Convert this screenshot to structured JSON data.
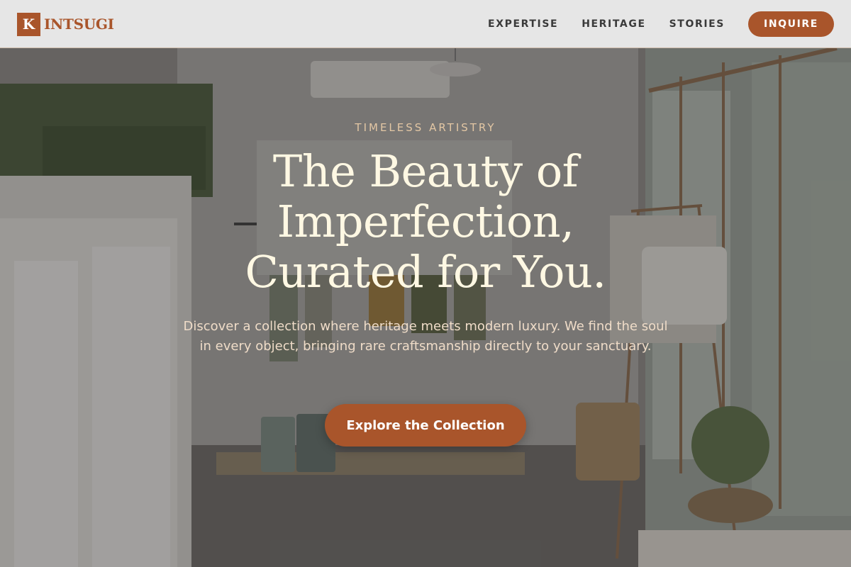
{
  "brand": {
    "mark": "K",
    "name": "INTSUGI",
    "color": "#a9552b"
  },
  "nav": {
    "items": [
      {
        "label": "EXPERTISE"
      },
      {
        "label": "HERITAGE"
      },
      {
        "label": "STORIES"
      }
    ],
    "cta_label": "INQUIRE"
  },
  "hero": {
    "eyebrow": "TIMELESS ARTISTRY",
    "headline_line1": "The Beauty of",
    "headline_line2": "Imperfection,",
    "headline_line3": "Curated for You.",
    "subtext": "Discover a collection where heritage meets modern luxury. We find the soul in every object, bringing rare craftsmanship directly to your sanctuary.",
    "cta_label": "Explore the Collection",
    "background_image": "clothing-boutique-interior-photo"
  },
  "colors": {
    "accent": "#a9552b",
    "headline": "#fff8e3",
    "eyebrow": "#e3c7a4",
    "header_bg": "#e6e6e6"
  }
}
